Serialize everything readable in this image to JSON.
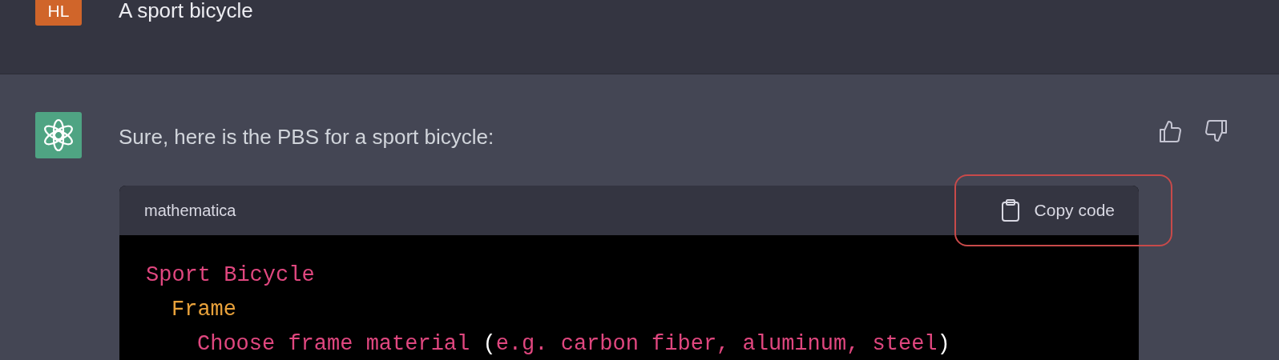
{
  "user_message": {
    "avatar": "HL",
    "text": "A sport bicycle"
  },
  "assistant_message": {
    "text": "Sure, here is the PBS for a sport bicycle:"
  },
  "code_block": {
    "language": "mathematica",
    "copy_button": {
      "label": "Copy code",
      "highlighted": true
    },
    "lines": [
      {
        "tokens": [
          {
            "text": "Sport Bicycle",
            "kind": "name"
          }
        ],
        "children": [
          {
            "tokens": [
              {
                "text": "Frame",
                "kind": "keyword"
              }
            ],
            "children": [
              {
                "tokens": [
                  {
                    "text": "Choose frame material ",
                    "kind": "name"
                  },
                  {
                    "text": "(",
                    "kind": "punct"
                  },
                  {
                    "text": "e.g. carbon fiber, aluminum, steel",
                    "kind": "name"
                  },
                  {
                    "text": ")",
                    "kind": "punct"
                  }
                ]
              }
            ]
          }
        ]
      }
    ]
  }
}
